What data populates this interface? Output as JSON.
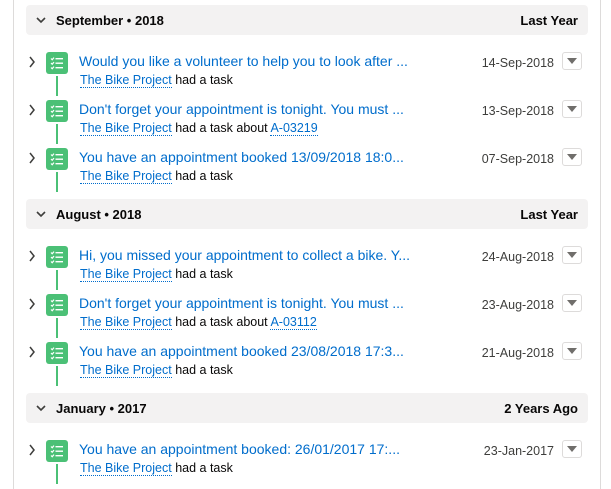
{
  "groups": [
    {
      "title": "September • 2018",
      "relative": "Last Year",
      "tasks": [
        {
          "subject": "Would you like a volunteer to help you to look after ...",
          "account": "The Bike Project",
          "action": "had a task",
          "about": "",
          "ref": "",
          "date": "14-Sep-2018"
        },
        {
          "subject": "Don't forget your appointment is tonight. You must ...",
          "account": "The Bike Project",
          "action": "had a task",
          "about": "about",
          "ref": "A-03219",
          "date": "13-Sep-2018"
        },
        {
          "subject": "You have an appointment booked 13/09/2018 18:0...",
          "account": "The Bike Project",
          "action": "had a task",
          "about": "",
          "ref": "",
          "date": "07-Sep-2018"
        }
      ]
    },
    {
      "title": "August • 2018",
      "relative": "Last Year",
      "tasks": [
        {
          "subject": "Hi, you missed your appointment to collect a bike. Y...",
          "account": "The Bike Project",
          "action": "had a task",
          "about": "",
          "ref": "",
          "date": "24-Aug-2018"
        },
        {
          "subject": "Don't forget your appointment is tonight. You must ...",
          "account": "The Bike Project",
          "action": "had a task",
          "about": "about",
          "ref": "A-03112",
          "date": "23-Aug-2018"
        },
        {
          "subject": "You have an appointment booked 23/08/2018 17:3...",
          "account": "The Bike Project",
          "action": "had a task",
          "about": "",
          "ref": "",
          "date": "21-Aug-2018"
        }
      ]
    },
    {
      "title": "January • 2017",
      "relative": "2 Years Ago",
      "tasks": [
        {
          "subject": "You have an appointment booked: 26/01/2017 17:...",
          "account": "The Bike Project",
          "action": "had a task",
          "about": "",
          "ref": "",
          "date": "23-Jan-2017"
        }
      ]
    }
  ],
  "icons": {
    "group_toggle": "chevron-down-icon",
    "row_toggle": "chevron-right-icon",
    "task": "task-list-icon",
    "menu": "caret-down-icon"
  },
  "colors": {
    "task_icon": "#4bc076",
    "link": "#006dcc",
    "header_bg": "#f3f2f2"
  }
}
